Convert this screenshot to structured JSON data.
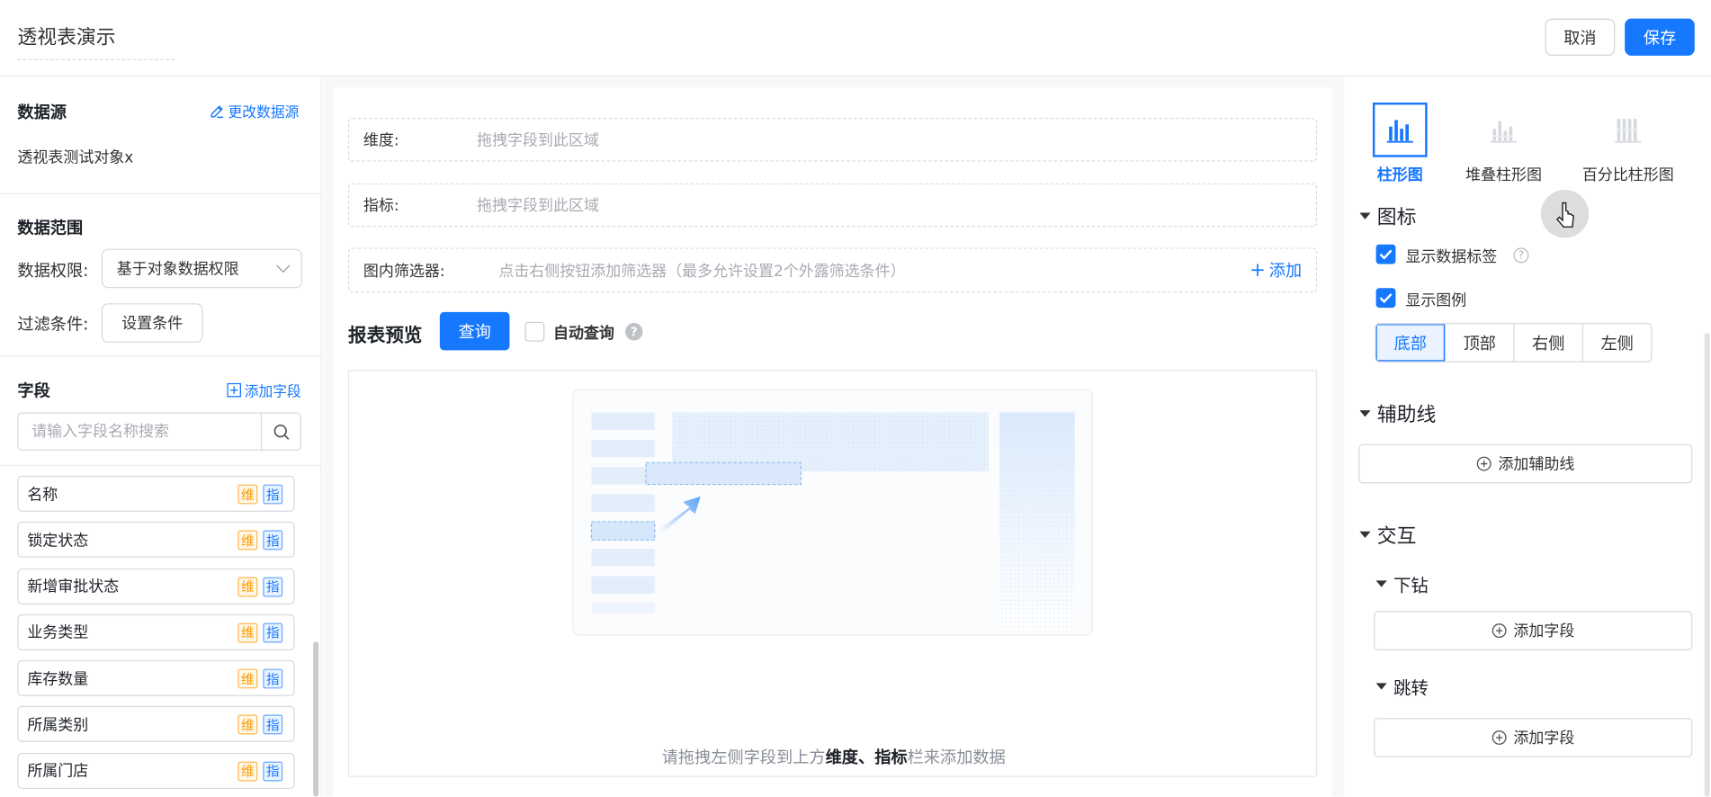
{
  "header": {
    "title": "透视表演示",
    "cancel": "取消",
    "save": "保存"
  },
  "left": {
    "datasource_title": "数据源",
    "change_datasource": "更改数据源",
    "datasource_name": "透视表测试对象x",
    "scope_title": "数据范围",
    "permission_label": "数据权限:",
    "permission_value": "基于对象数据权限",
    "filter_label": "过滤条件:",
    "filter_button": "设置条件",
    "fields_title": "字段",
    "add_field": "添加字段",
    "search_placeholder": "请输入字段名称搜索",
    "dim_tag": "维",
    "ind_tag": "指",
    "fields": [
      "名称",
      "锁定状态",
      "新增审批状态",
      "业务类型",
      "库存数量",
      "所属类别",
      "所属门店"
    ]
  },
  "center": {
    "dimension_label": "维度:",
    "indicator_label": "指标:",
    "drop_placeholder": "拖拽字段到此区域",
    "filter_label": "图内筛选器:",
    "filter_placeholder": "点击右侧按钮添加筛选器（最多允许设置2个外露筛选条件）",
    "add": "添加",
    "preview_title": "报表预览",
    "query": "查询",
    "auto_query": "自动查询",
    "hint_prefix": "请拖拽左侧字段到上方",
    "hint_bold": "维度、指标",
    "hint_suffix": "栏来添加数据"
  },
  "right": {
    "chart_types": [
      {
        "label": "柱形图",
        "selected": true
      },
      {
        "label": "堆叠柱形图",
        "selected": false
      },
      {
        "label": "百分比柱形图",
        "selected": false
      }
    ],
    "legend_section": "图标",
    "show_data_label": "显示数据标签",
    "show_legend": "显示图例",
    "positions": [
      "底部",
      "顶部",
      "右侧",
      "左侧"
    ],
    "selected_position": "底部",
    "guide_section": "辅助线",
    "add_guide": "添加辅助线",
    "interact_section": "交互",
    "drill_section": "下钻",
    "jump_section": "跳转",
    "add_field": "添加字段"
  },
  "colors": {
    "primary": "#1677ff",
    "dim_tag": "#ff9900"
  }
}
